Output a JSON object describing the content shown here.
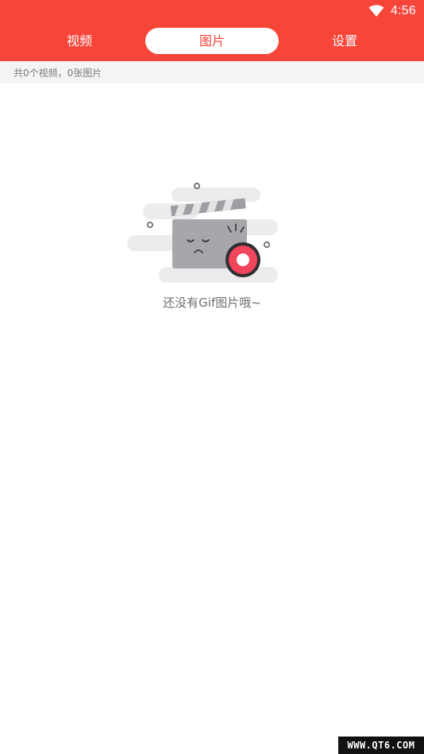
{
  "status_bar": {
    "time": "4:56",
    "wifi_icon": "wifi-icon"
  },
  "tabs": [
    {
      "label": "视频",
      "active": false
    },
    {
      "label": "图片",
      "active": true
    },
    {
      "label": "设置",
      "active": false
    }
  ],
  "summary": {
    "text": "共0个视频，0张图片"
  },
  "empty_state": {
    "icon": "clapperboard-sad-icon",
    "message": "还没有Gif图片哦~"
  },
  "watermark": {
    "text": "WWW.QT6.COM"
  },
  "colors": {
    "brand": "#f8453a",
    "summary_bg": "#f4f4f4",
    "text_muted": "#6e6e6e"
  }
}
